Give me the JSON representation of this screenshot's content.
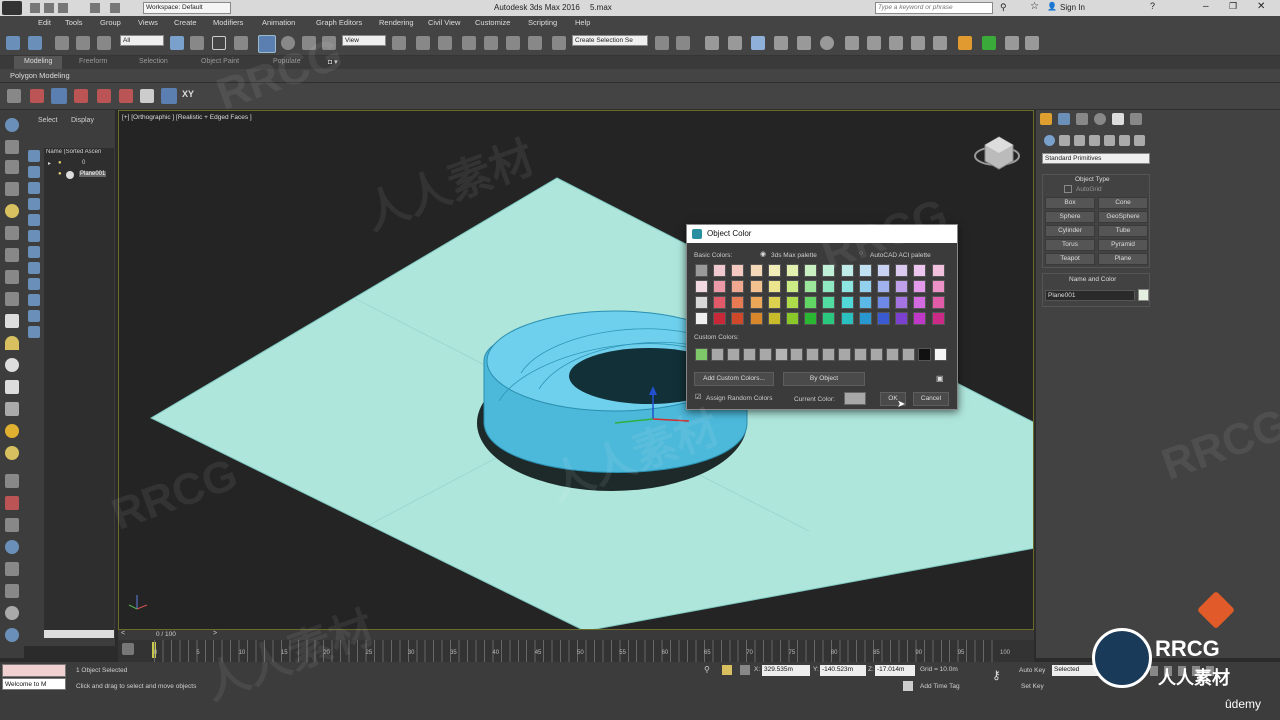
{
  "title_bar": {
    "workspace": "Workspace: Default",
    "app_title": "Autodesk 3ds Max 2016",
    "filename": "5.max",
    "search_placeholder": "Type a keyword or phrase",
    "sign_in": "Sign In"
  },
  "menu": [
    "Edit",
    "Tools",
    "Group",
    "Views",
    "Create",
    "Modifiers",
    "Animation",
    "Graph Editors",
    "Rendering",
    "Civil View",
    "Customize",
    "Scripting",
    "Help"
  ],
  "toolbar": {
    "filter": "All",
    "ref_coord": "View",
    "selection_set": "Create Selection Se"
  },
  "ribbon": {
    "tabs": [
      "Modeling",
      "Freeform",
      "Selection",
      "Object Paint",
      "Populate"
    ],
    "subtitle": "Polygon Modeling"
  },
  "scene_explorer": {
    "tabs": [
      "Select",
      "Display"
    ],
    "header": "Name (Sorted Ascen",
    "items": [
      "0",
      "Plane001"
    ]
  },
  "viewport": {
    "label": "[+] [Orthographic ] [Realistic + Edged Faces ]"
  },
  "command_panel": {
    "category": "Standard Primitives",
    "object_type_title": "Object Type",
    "autogrid": "AutoGrid",
    "buttons": [
      "Box",
      "Cone",
      "Sphere",
      "GeoSphere",
      "Cylinder",
      "Tube",
      "Torus",
      "Pyramid",
      "Teapot",
      "Plane"
    ],
    "name_color_title": "Name and Color",
    "object_name": "Plane001"
  },
  "dialog": {
    "title": "Object Color",
    "basic_colors_label": "Basic Colors:",
    "palette_3dsmax": "3ds Max palette",
    "palette_aci": "AutoCAD ACI palette",
    "custom_colors_label": "Custom Colors:",
    "add_custom": "Add Custom Colors...",
    "by_object": "By Object",
    "assign_random": "Assign Random Colors",
    "current_color_label": "Current Color:",
    "ok": "OK",
    "cancel": "Cancel",
    "basic_colors": [
      [
        "#9a9a9a",
        "#f0c8d0",
        "#f5c8c0",
        "#f5d8b8",
        "#f2ecb8",
        "#e2f0b0",
        "#c8f0c0",
        "#c0f0d8",
        "#bfece8",
        "#c0e2f2",
        "#c8d2f2",
        "#dacaf0",
        "#ecc6ee",
        "#f0c0dc"
      ],
      [
        "#f2d8e0",
        "#ec9aa8",
        "#f0a890",
        "#f2c290",
        "#ede48e",
        "#ccec86",
        "#9ce69c",
        "#8ee8c2",
        "#8ee6e2",
        "#92d0ee",
        "#a0b2ee",
        "#c0a2ec",
        "#e49aea",
        "#ec92c6"
      ],
      [
        "#d8d8d8",
        "#e05a6a",
        "#e87a54",
        "#eca858",
        "#dcd250",
        "#aedc4a",
        "#62d664",
        "#52dca2",
        "#52d8d6",
        "#5cb8e4",
        "#6e8ae6",
        "#a474e2",
        "#d46ae0",
        "#e05ca8"
      ],
      [
        "#efefef",
        "#c82838",
        "#d0482a",
        "#d8882a",
        "#c8ba2a",
        "#8ac82a",
        "#2ab832",
        "#2ac87e",
        "#2ac0c0",
        "#2a98d0",
        "#3a5ad2",
        "#7c40d0",
        "#c038c8",
        "#cc2a86"
      ]
    ],
    "custom_colors": [
      "#7ec86a",
      "#a8a8a8",
      "#a8a8a8",
      "#a8a8a8",
      "#a8a8a8",
      "#b4b4b4",
      "#a8a8a8",
      "#a8a8a8",
      "#a8a8a8",
      "#a8a8a8",
      "#a8a8a8",
      "#a8a8a8",
      "#a8a8a8",
      "#a8a8a8",
      "#111111",
      "#f5f5f5"
    ],
    "current_color": "#a8a8a8"
  },
  "timeline": {
    "frame": "0 / 100",
    "ticks": [
      "0",
      "5",
      "10",
      "15",
      "20",
      "25",
      "30",
      "35",
      "40",
      "45",
      "50",
      "55",
      "60",
      "65",
      "70",
      "75",
      "80",
      "85",
      "90",
      "95",
      "100"
    ]
  },
  "status": {
    "maxscript": "Welcome to M",
    "selected": "1 Object Selected",
    "prompt": "Click and drag to select and move objects",
    "x": "329.535m",
    "y": "-140.523m",
    "z": "-17.014m",
    "grid": "Grid = 10.0m",
    "add_time_tag": "Add Time Tag",
    "auto_key": "Auto Key",
    "selected_dd": "Selected",
    "set_key": "Set Key"
  },
  "colors": {
    "plane": "#aee6dc",
    "object": "#5ec8e6",
    "viewport_bg": "#242424",
    "ui_bg": "#444444"
  },
  "watermarks": {
    "rrcg": "RRCG",
    "cn": "人人素材",
    "udemy": "ûdemy"
  }
}
